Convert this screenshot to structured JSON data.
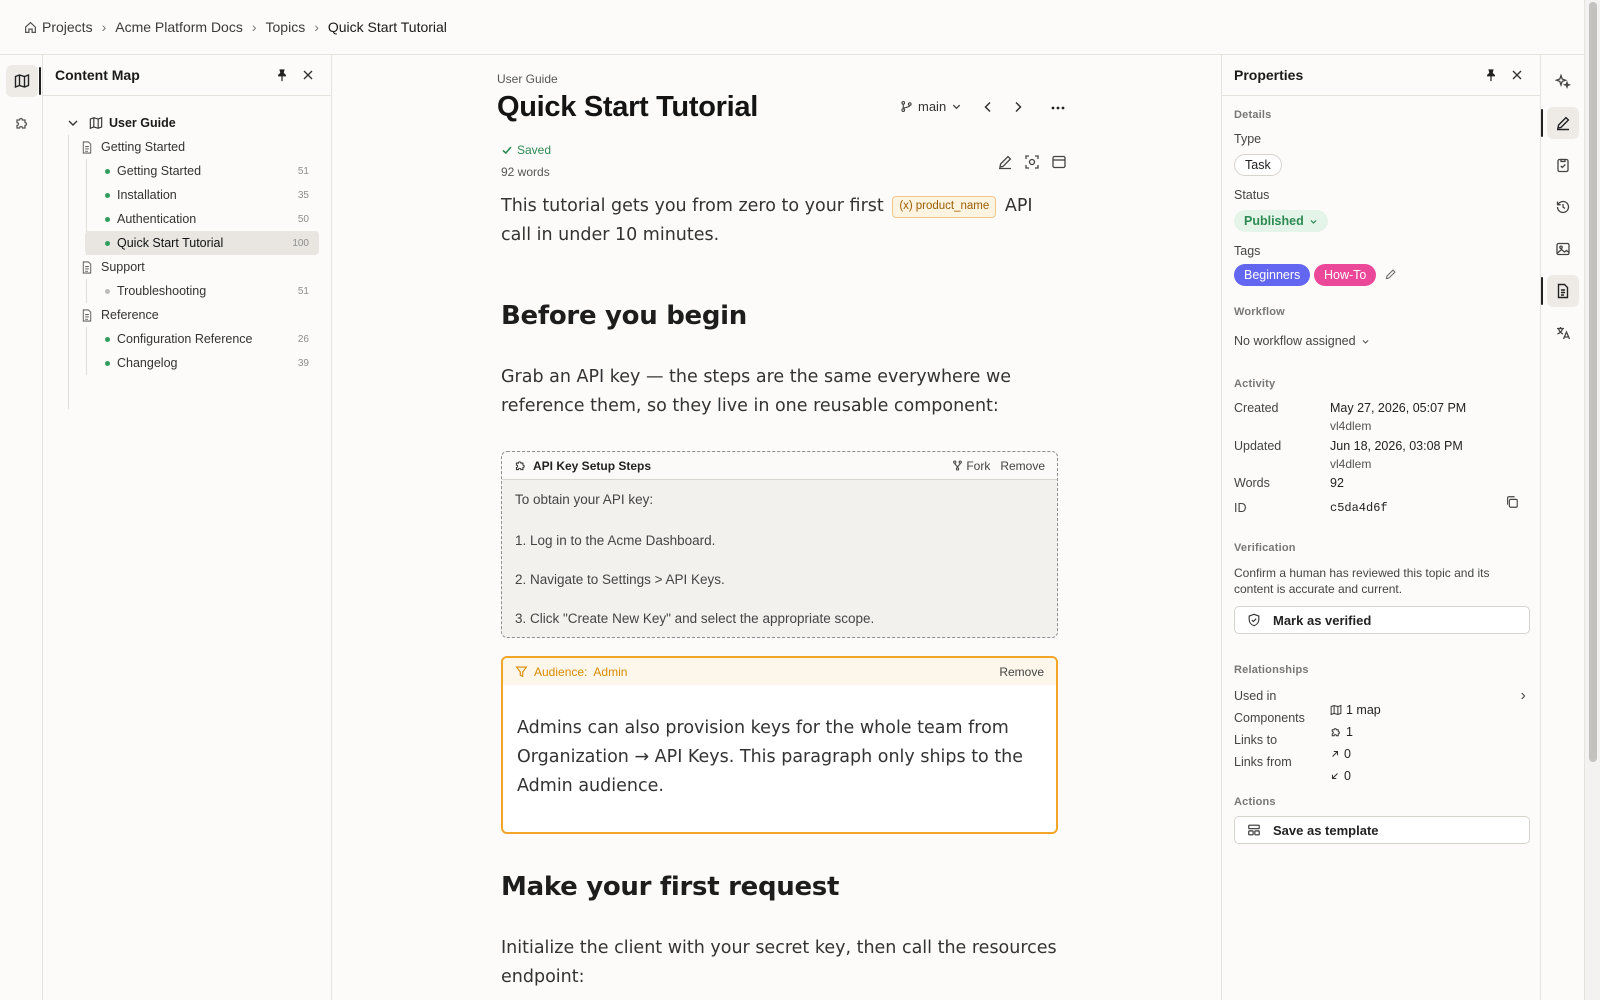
{
  "breadcrumb": {
    "items": [
      "Projects",
      "Acme Platform Docs",
      "Topics",
      "Quick Start Tutorial"
    ]
  },
  "content_map": {
    "title": "Content Map",
    "root": "User Guide",
    "groups": [
      {
        "label": "Getting Started",
        "items": [
          {
            "label": "Getting Started",
            "count": "51",
            "status": "green"
          },
          {
            "label": "Installation",
            "count": "35",
            "status": "green"
          },
          {
            "label": "Authentication",
            "count": "50",
            "status": "green"
          },
          {
            "label": "Quick Start Tutorial",
            "count": "100",
            "status": "green",
            "selected": true
          }
        ]
      },
      {
        "label": "Support",
        "items": [
          {
            "label": "Troubleshooting",
            "count": "51",
            "status": "grey"
          }
        ]
      },
      {
        "label": "Reference",
        "items": [
          {
            "label": "Configuration Reference",
            "count": "26",
            "status": "green"
          },
          {
            "label": "Changelog",
            "count": "39",
            "status": "green"
          }
        ]
      }
    ]
  },
  "document": {
    "kicker": "User Guide",
    "title": "Quick Start Tutorial",
    "branch": "main",
    "saved": "Saved",
    "word_count": "92 words",
    "intro_before": "This tutorial gets you from zero to your first",
    "variable": "product_name",
    "intro_after": "API call in under 10 minutes.",
    "heading1": "Before you begin",
    "para1": "Grab an API key — the steps are the same everywhere we reference them, so they live in one reusable component:",
    "component": {
      "title": "API Key Setup Steps",
      "fork": "Fork",
      "remove": "Remove",
      "lines": [
        "To obtain your API key:",
        "1. Log in to the Acme Dashboard.",
        "2. Navigate to Settings > API Keys.",
        "3. Click \"Create New Key\" and select the appropriate scope."
      ]
    },
    "audience": {
      "label": "Audience:",
      "value": "Admin",
      "remove": "Remove",
      "text": "Admins can also provision keys for the whole team from Organization → API Keys. This paragraph only ships to the Admin audience."
    },
    "heading2": "Make your first request",
    "para2": "Initialize the client with your secret key, then call the resources endpoint:"
  },
  "properties": {
    "title": "Properties",
    "details_label": "Details",
    "type_label": "Type",
    "type_value": "Task",
    "status_label": "Status",
    "status_value": "Published",
    "tags_label": "Tags",
    "tags": [
      {
        "label": "Beginners",
        "color": "#6366f1"
      },
      {
        "label": "How-To",
        "color": "#ec4899"
      }
    ],
    "workflow_label": "Workflow",
    "workflow_value": "No workflow assigned",
    "activity_label": "Activity",
    "created_label": "Created",
    "created_value": "May 27, 2026, 05:07 PM",
    "created_by": "vl4dlem",
    "updated_label": "Updated",
    "updated_value": "Jun 18, 2026, 03:08 PM",
    "updated_by": "vl4dlem",
    "words_label": "Words",
    "words_value": "92",
    "id_label": "ID",
    "id_value": "c5da4d6f",
    "verification_label": "Verification",
    "verification_text": "Confirm a human has reviewed this topic and its content is accurate and current.",
    "verify_button": "Mark as verified",
    "relationships_label": "Relationships",
    "used_in_label": "Used in",
    "used_in_value": "1 map",
    "components_label": "Components",
    "components_value": "1",
    "links_to_label": "Links to",
    "links_to_value": "0",
    "links_from_label": "Links from",
    "links_from_value": "0",
    "actions_label": "Actions",
    "template_button": "Save as template"
  },
  "colors": {
    "accent_green": "#2d8a52",
    "audience_orange": "#f2a526",
    "variable_amber": "#9b5e00"
  }
}
